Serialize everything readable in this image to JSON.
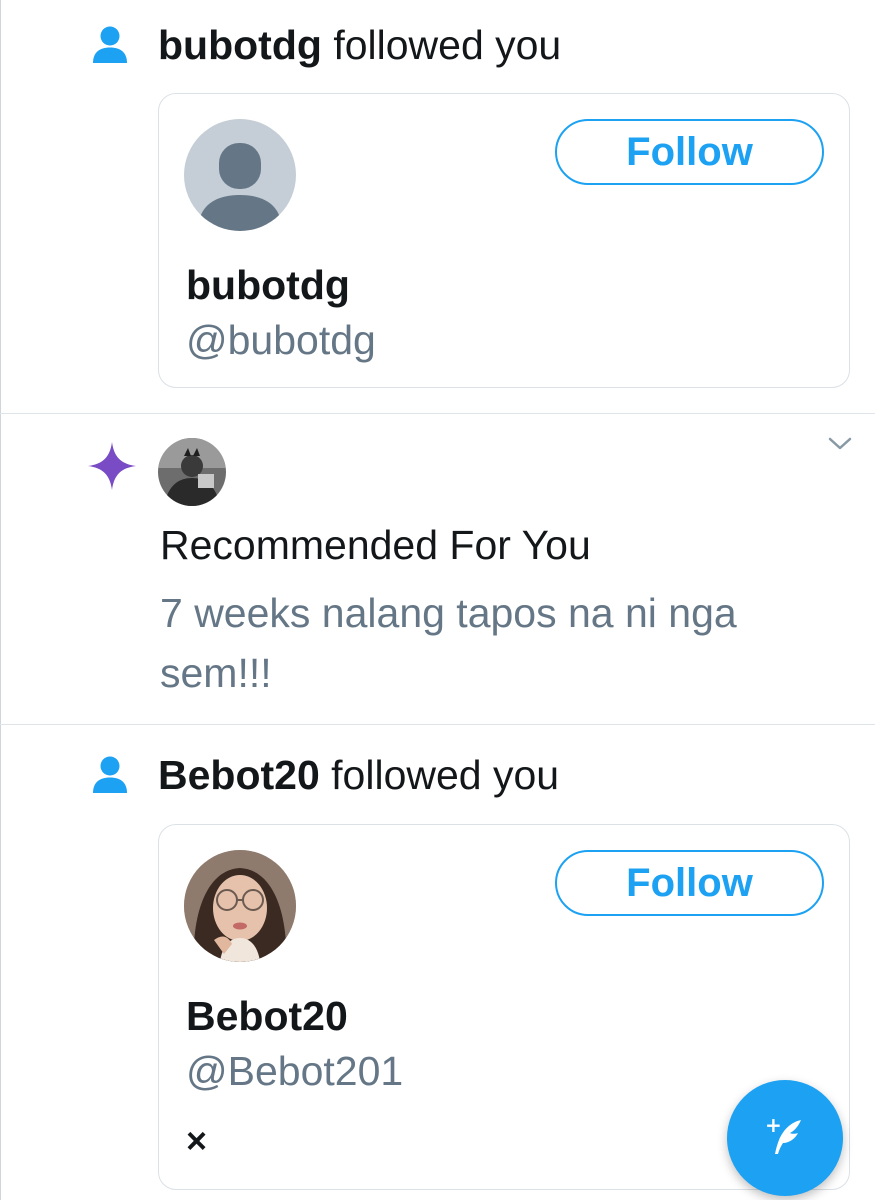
{
  "colors": {
    "accent": "#1da1f2",
    "secondary_text": "#657786",
    "primary_text": "#14171a",
    "sparkle": "#794bc4",
    "divider": "#dfe4e8"
  },
  "notifications": [
    {
      "icon": "person-icon",
      "actor": "bubotdg",
      "action": " followed you",
      "card": {
        "name": "bubotdg",
        "handle": "@bubotdg",
        "follow_label": "Follow",
        "avatar": "default-avatar"
      }
    },
    {
      "icon": "sparkle-icon",
      "title": "Recommended For You",
      "body": "7 weeks nalang tapos na ni nga sem!!!",
      "avatar": "user-photo-avatar",
      "menu_icon": "chevron-down-icon"
    },
    {
      "icon": "person-icon",
      "actor": "Bebot20",
      "action": " followed you",
      "card": {
        "name": "Bebot20",
        "handle": "@Bebot201",
        "follow_label": "Follow",
        "avatar": "user-photo-avatar",
        "dismiss_label": "×"
      }
    }
  ],
  "fab": {
    "icon": "compose-tweet-icon",
    "plus": "+"
  }
}
